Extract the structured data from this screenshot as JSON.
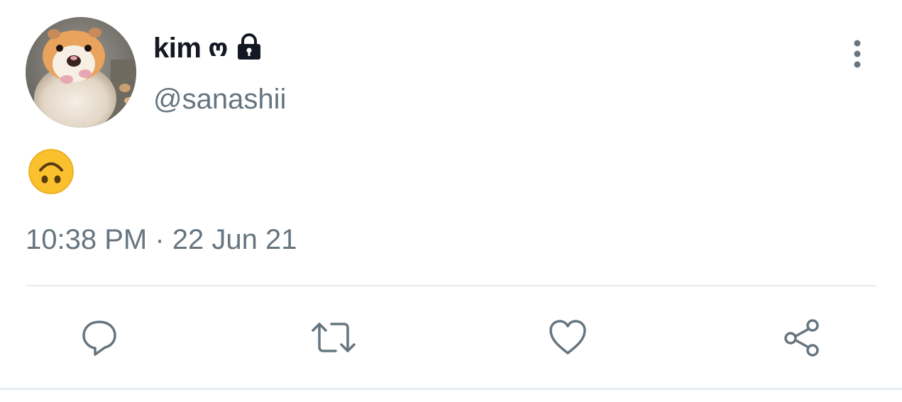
{
  "tweet": {
    "author": {
      "display_name": "kim",
      "name_glyph": "ო",
      "handle": "@sanashii",
      "protected": true,
      "avatar_icon": "hamster-avatar"
    },
    "body_emoji": "upside-down-face-emoji",
    "timestamp": "10:38 PM · 22 Jun 21"
  },
  "actions": [
    {
      "name": "reply",
      "icon": "reply-icon"
    },
    {
      "name": "retweet",
      "icon": "retweet-icon"
    },
    {
      "name": "like",
      "icon": "heart-icon"
    },
    {
      "name": "share",
      "icon": "share-icon"
    }
  ],
  "colors": {
    "text_primary": "#141823",
    "text_secondary": "#66757f",
    "divider": "#e6ecf0",
    "emoji_yellow": "#fbc02d"
  }
}
